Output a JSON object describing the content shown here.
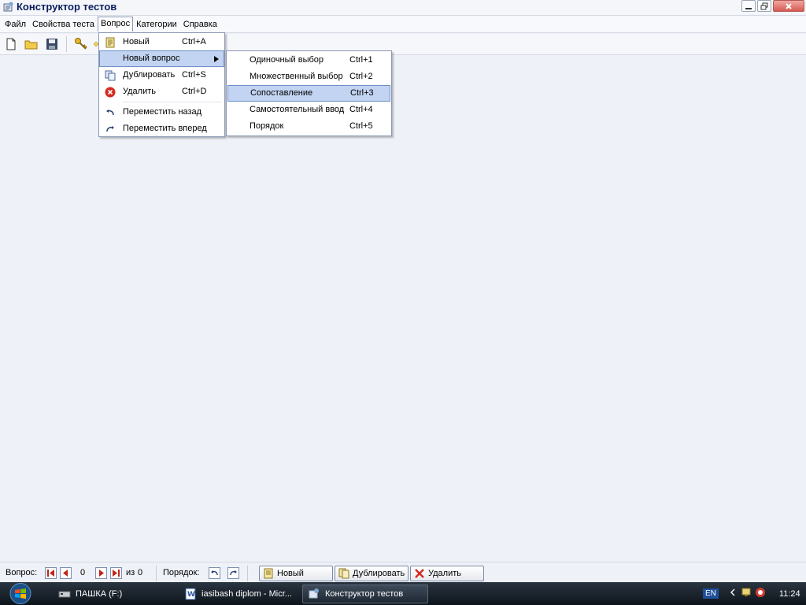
{
  "window": {
    "title": "Конструктор тестов",
    "controls": [
      "minimize",
      "restore",
      "close"
    ]
  },
  "menubar": {
    "items": [
      {
        "label": "Файл"
      },
      {
        "label": "Свойства теста"
      },
      {
        "label": "Вопрос",
        "open": true
      },
      {
        "label": "Категории"
      },
      {
        "label": "Справка"
      }
    ]
  },
  "toolbar": {
    "buttons": [
      "new-file-icon",
      "open-folder-icon",
      "save-icon",
      "key-icon",
      "diamond-icon"
    ]
  },
  "vopros_menu": {
    "items": [
      {
        "label": "Новый",
        "shortcut": "Ctrl+A",
        "icon": "new-question-icon"
      },
      {
        "label": "Новый вопрос",
        "shortcut": "",
        "submenu": true,
        "highlighted": true
      },
      {
        "label": "Дублировать",
        "shortcut": "Ctrl+S",
        "icon": "duplicate-icon"
      },
      {
        "label": "Удалить",
        "shortcut": "Ctrl+D",
        "icon": "delete-icon"
      },
      {
        "label": "Переместить назад",
        "shortcut": "",
        "icon": "move-back-icon"
      },
      {
        "label": "Переместить вперед",
        "shortcut": "",
        "icon": "move-forward-icon"
      }
    ]
  },
  "new_question_menu": {
    "items": [
      {
        "label": "Одиночный выбор",
        "shortcut": "Ctrl+1"
      },
      {
        "label": "Множественный выбор",
        "shortcut": "Ctrl+2"
      },
      {
        "label": "Сопоставление",
        "shortcut": "Ctrl+3",
        "highlighted": true
      },
      {
        "label": "Самостоятельный ввод",
        "shortcut": "Ctrl+4"
      },
      {
        "label": "Порядок",
        "shortcut": "Ctrl+5"
      }
    ]
  },
  "bottombar": {
    "question_label": "Вопрос:",
    "current": "0",
    "of_label": "из",
    "total": "0",
    "order_label": "Порядок:",
    "new_button": "Новый",
    "duplicate_button": "Дублировать",
    "delete_button": "Удалить"
  },
  "taskbar": {
    "tasks": [
      {
        "label": "ПАШКА (F:)"
      },
      {
        "label": "iasibash diplom - Micr..."
      },
      {
        "label": "Конструктор тестов",
        "active": true
      }
    ],
    "language": "EN",
    "clock": "11:24"
  },
  "colors": {
    "title_text": "#0a1e5c",
    "menu_highlight": "#c2d4f1",
    "client_bg": "#eef2f8",
    "delete_red": "#d42a1f"
  }
}
